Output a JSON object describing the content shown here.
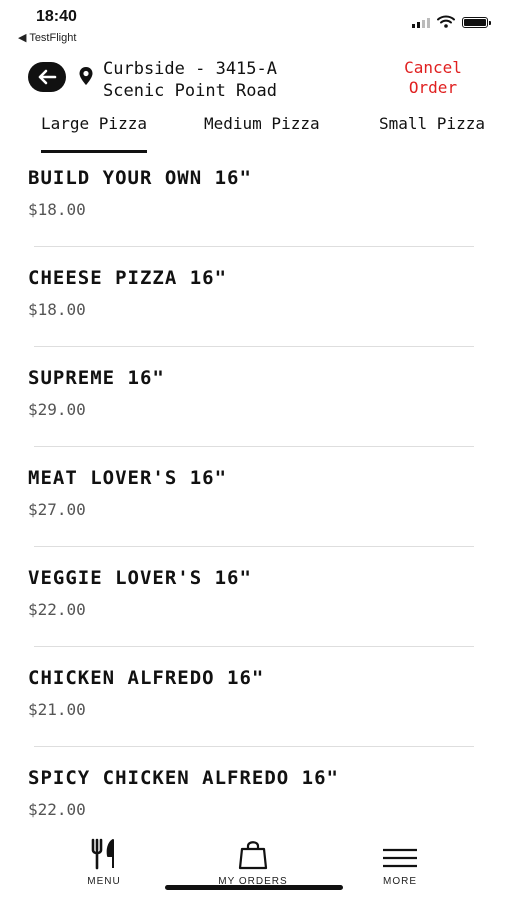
{
  "status_bar": {
    "time": "18:40",
    "back_app": "◀ TestFlight"
  },
  "header": {
    "location_line1": "Curbside - 3415-A",
    "location_line2": "Scenic Point Road",
    "cancel_line1": "Cancel",
    "cancel_line2": "Order",
    "cancel_color": "#e02020"
  },
  "tabs": [
    {
      "label": "Large Pizza",
      "active": true
    },
    {
      "label": "Medium Pizza",
      "active": false
    },
    {
      "label": "Small Pizza",
      "active": false
    }
  ],
  "menu_items": [
    {
      "name": "BUILD YOUR OWN 16\"",
      "price": "$18.00"
    },
    {
      "name": "CHEESE PIZZA 16\"",
      "price": "$18.00"
    },
    {
      "name": "SUPREME 16\"",
      "price": "$29.00"
    },
    {
      "name": "MEAT LOVER'S 16\"",
      "price": "$27.00"
    },
    {
      "name": "VEGGIE LOVER'S 16\"",
      "price": "$22.00"
    },
    {
      "name": "CHICKEN ALFREDO 16\"",
      "price": "$21.00"
    },
    {
      "name": "SPICY CHICKEN ALFREDO 16\"",
      "price": "$22.00"
    }
  ],
  "bottom_nav": [
    {
      "label": "MENU",
      "icon": "fork-knife-icon"
    },
    {
      "label": "MY ORDERS",
      "icon": "shopping-bag-icon"
    },
    {
      "label": "MORE",
      "icon": "hamburger-menu-icon"
    }
  ]
}
